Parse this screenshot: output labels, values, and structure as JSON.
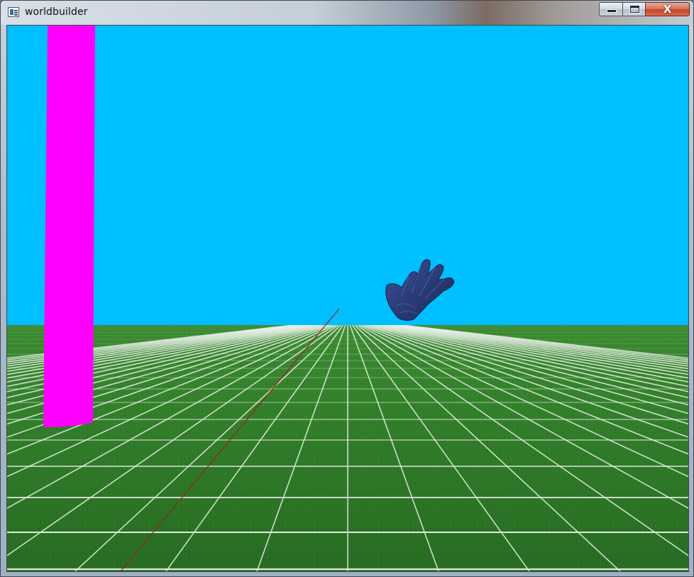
{
  "window": {
    "title": "worldbuilder",
    "icon": "app-window-icon",
    "controls": {
      "minimize_icon": "minimize-icon",
      "maximize_icon": "maximize-icon",
      "close_label": "X"
    }
  },
  "scene": {
    "sky_color": "#00bfff",
    "ground_color": "#2f7a28",
    "grid_line_color": "#e8f0e6",
    "pillar_color": "#ff00ff",
    "hand_color": "#2c3f7a",
    "pointer_ray_color": "#9a2222"
  }
}
